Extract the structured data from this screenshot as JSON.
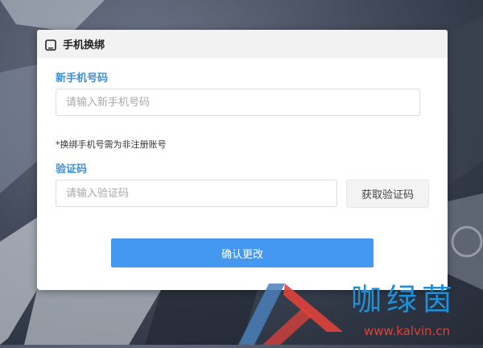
{
  "dialog": {
    "title": "手机换绑",
    "new_phone_label": "新手机号码",
    "new_phone_placeholder": "请输入新手机号码",
    "hint": "*换绑手机号需为非注册账号",
    "code_label": "验证码",
    "code_placeholder": "请输入验证码",
    "get_code_button": "获取验证码",
    "confirm_button": "确认更改"
  },
  "watermark": {
    "brand": "咖绿茵",
    "url": "www.kalvin.cn"
  },
  "colors": {
    "accent": "#4498f0",
    "label": "#3a8fd9",
    "watermark_blue": "#1e90d8",
    "watermark_red": "#e0413a"
  },
  "icons": {
    "header_icon": "phone-icon"
  }
}
